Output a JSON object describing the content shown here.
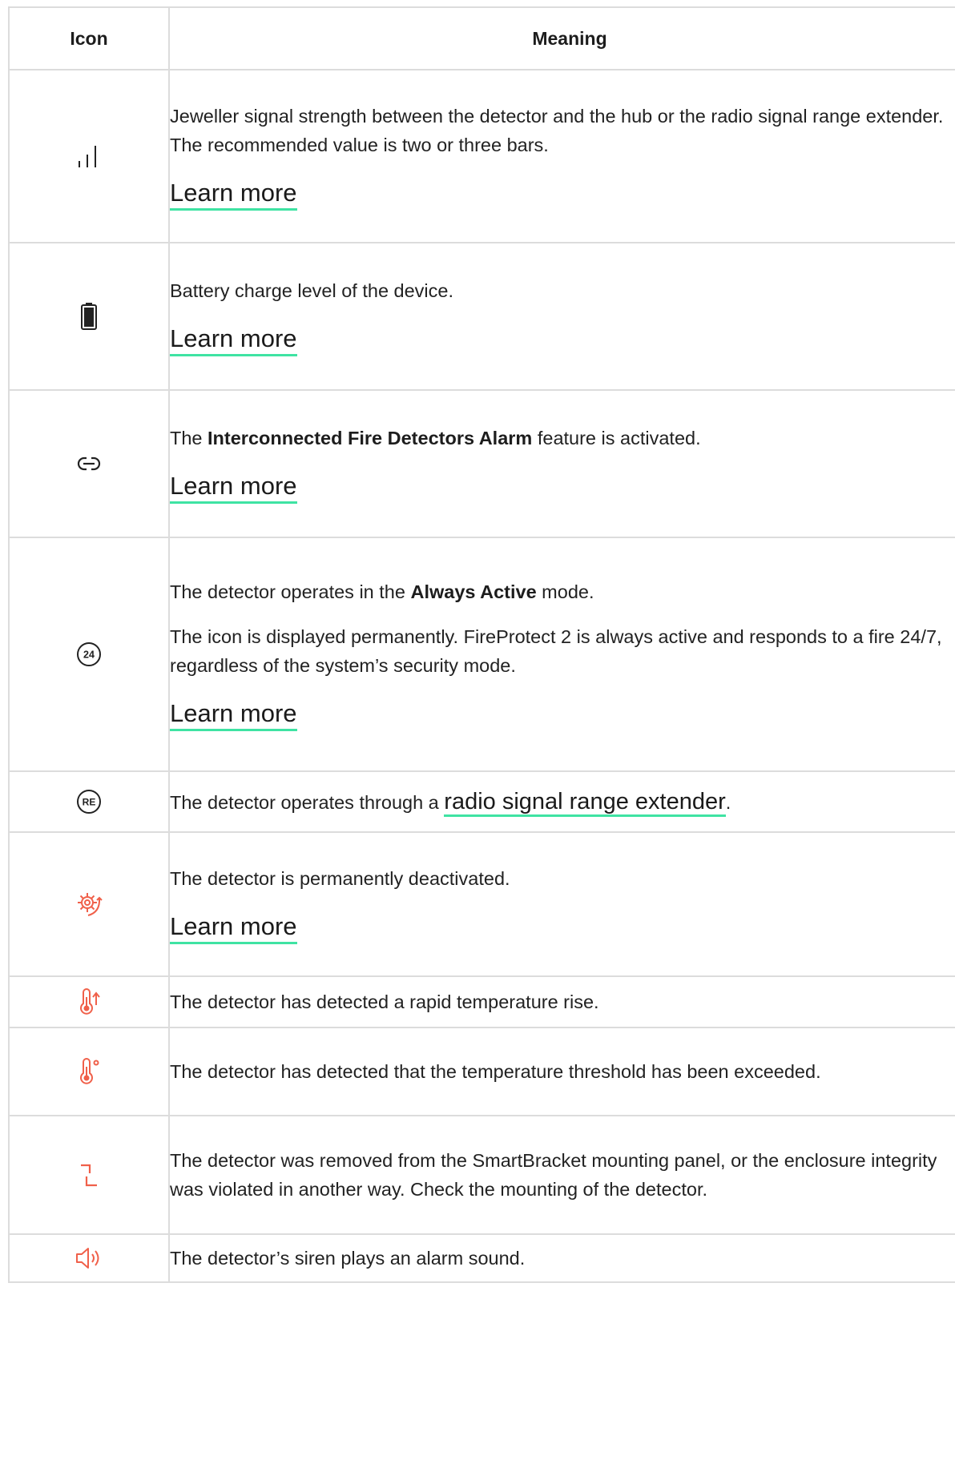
{
  "table": {
    "headers": {
      "icon": "Icon",
      "meaning": "Meaning"
    },
    "rows": [
      {
        "icon": "signal-strength-icon",
        "icon_color": "#222222",
        "text": "Jeweller signal strength between the detector and the hub or the radio signal range extender. The recommended value is two or three bars.",
        "link": "Learn more"
      },
      {
        "icon": "battery-icon",
        "icon_color": "#222222",
        "text": "Battery charge level of the device.",
        "link": "Learn more"
      },
      {
        "icon": "link-icon",
        "icon_color": "#222222",
        "text_before": "The ",
        "text_bold": "Interconnected Fire Detectors Alarm",
        "text_after": " feature is activated.",
        "link": "Learn more"
      },
      {
        "icon": "always-active-24-icon",
        "icon_label": "24",
        "icon_color": "#222222",
        "text_before": "The detector operates in the ",
        "text_bold": "Always Active",
        "text_after": " mode.",
        "text2": "The icon is displayed permanently. FireProtect 2 is always active and responds to a fire 24/7, regardless of the system’s security mode.",
        "link": "Learn more"
      },
      {
        "icon": "range-extender-re-icon",
        "icon_label": "RE",
        "icon_color": "#222222",
        "text_before": "The detector operates through a ",
        "link": "radio signal range extender",
        "text_after": "."
      },
      {
        "icon": "deactivated-gear-icon",
        "icon_color": "#f0604a",
        "text": "The detector is permanently deactivated.",
        "link": "Learn more"
      },
      {
        "icon": "temperature-rise-icon",
        "icon_color": "#f0604a",
        "text": "The detector has detected a rapid temperature rise."
      },
      {
        "icon": "temperature-threshold-icon",
        "icon_color": "#f0604a",
        "text": "The detector has detected that the temperature threshold has been exceeded."
      },
      {
        "icon": "tamper-icon",
        "icon_color": "#f0604a",
        "text": "The detector was removed from the SmartBracket mounting panel, or the enclosure integrity was violated in another way. Check the mounting of the detector."
      },
      {
        "icon": "siren-speaker-icon",
        "icon_color": "#f0604a",
        "text": "The detector’s siren plays an alarm sound."
      }
    ]
  }
}
